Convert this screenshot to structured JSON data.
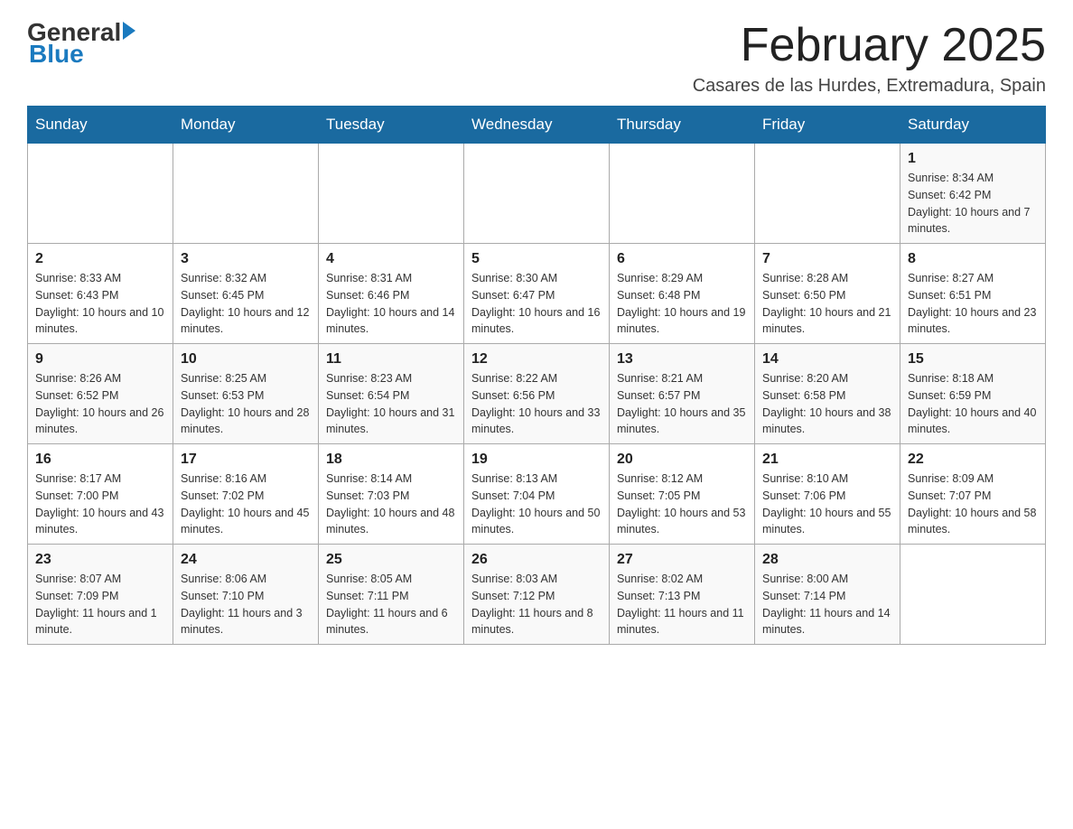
{
  "logo": {
    "general": "General",
    "blue": "Blue"
  },
  "title": "February 2025",
  "location": "Casares de las Hurdes, Extremadura, Spain",
  "days_of_week": [
    "Sunday",
    "Monday",
    "Tuesday",
    "Wednesday",
    "Thursday",
    "Friday",
    "Saturday"
  ],
  "weeks": [
    [
      {
        "day": "",
        "info": ""
      },
      {
        "day": "",
        "info": ""
      },
      {
        "day": "",
        "info": ""
      },
      {
        "day": "",
        "info": ""
      },
      {
        "day": "",
        "info": ""
      },
      {
        "day": "",
        "info": ""
      },
      {
        "day": "1",
        "info": "Sunrise: 8:34 AM\nSunset: 6:42 PM\nDaylight: 10 hours and 7 minutes."
      }
    ],
    [
      {
        "day": "2",
        "info": "Sunrise: 8:33 AM\nSunset: 6:43 PM\nDaylight: 10 hours and 10 minutes."
      },
      {
        "day": "3",
        "info": "Sunrise: 8:32 AM\nSunset: 6:45 PM\nDaylight: 10 hours and 12 minutes."
      },
      {
        "day": "4",
        "info": "Sunrise: 8:31 AM\nSunset: 6:46 PM\nDaylight: 10 hours and 14 minutes."
      },
      {
        "day": "5",
        "info": "Sunrise: 8:30 AM\nSunset: 6:47 PM\nDaylight: 10 hours and 16 minutes."
      },
      {
        "day": "6",
        "info": "Sunrise: 8:29 AM\nSunset: 6:48 PM\nDaylight: 10 hours and 19 minutes."
      },
      {
        "day": "7",
        "info": "Sunrise: 8:28 AM\nSunset: 6:50 PM\nDaylight: 10 hours and 21 minutes."
      },
      {
        "day": "8",
        "info": "Sunrise: 8:27 AM\nSunset: 6:51 PM\nDaylight: 10 hours and 23 minutes."
      }
    ],
    [
      {
        "day": "9",
        "info": "Sunrise: 8:26 AM\nSunset: 6:52 PM\nDaylight: 10 hours and 26 minutes."
      },
      {
        "day": "10",
        "info": "Sunrise: 8:25 AM\nSunset: 6:53 PM\nDaylight: 10 hours and 28 minutes."
      },
      {
        "day": "11",
        "info": "Sunrise: 8:23 AM\nSunset: 6:54 PM\nDaylight: 10 hours and 31 minutes."
      },
      {
        "day": "12",
        "info": "Sunrise: 8:22 AM\nSunset: 6:56 PM\nDaylight: 10 hours and 33 minutes."
      },
      {
        "day": "13",
        "info": "Sunrise: 8:21 AM\nSunset: 6:57 PM\nDaylight: 10 hours and 35 minutes."
      },
      {
        "day": "14",
        "info": "Sunrise: 8:20 AM\nSunset: 6:58 PM\nDaylight: 10 hours and 38 minutes."
      },
      {
        "day": "15",
        "info": "Sunrise: 8:18 AM\nSunset: 6:59 PM\nDaylight: 10 hours and 40 minutes."
      }
    ],
    [
      {
        "day": "16",
        "info": "Sunrise: 8:17 AM\nSunset: 7:00 PM\nDaylight: 10 hours and 43 minutes."
      },
      {
        "day": "17",
        "info": "Sunrise: 8:16 AM\nSunset: 7:02 PM\nDaylight: 10 hours and 45 minutes."
      },
      {
        "day": "18",
        "info": "Sunrise: 8:14 AM\nSunset: 7:03 PM\nDaylight: 10 hours and 48 minutes."
      },
      {
        "day": "19",
        "info": "Sunrise: 8:13 AM\nSunset: 7:04 PM\nDaylight: 10 hours and 50 minutes."
      },
      {
        "day": "20",
        "info": "Sunrise: 8:12 AM\nSunset: 7:05 PM\nDaylight: 10 hours and 53 minutes."
      },
      {
        "day": "21",
        "info": "Sunrise: 8:10 AM\nSunset: 7:06 PM\nDaylight: 10 hours and 55 minutes."
      },
      {
        "day": "22",
        "info": "Sunrise: 8:09 AM\nSunset: 7:07 PM\nDaylight: 10 hours and 58 minutes."
      }
    ],
    [
      {
        "day": "23",
        "info": "Sunrise: 8:07 AM\nSunset: 7:09 PM\nDaylight: 11 hours and 1 minute."
      },
      {
        "day": "24",
        "info": "Sunrise: 8:06 AM\nSunset: 7:10 PM\nDaylight: 11 hours and 3 minutes."
      },
      {
        "day": "25",
        "info": "Sunrise: 8:05 AM\nSunset: 7:11 PM\nDaylight: 11 hours and 6 minutes."
      },
      {
        "day": "26",
        "info": "Sunrise: 8:03 AM\nSunset: 7:12 PM\nDaylight: 11 hours and 8 minutes."
      },
      {
        "day": "27",
        "info": "Sunrise: 8:02 AM\nSunset: 7:13 PM\nDaylight: 11 hours and 11 minutes."
      },
      {
        "day": "28",
        "info": "Sunrise: 8:00 AM\nSunset: 7:14 PM\nDaylight: 11 hours and 14 minutes."
      },
      {
        "day": "",
        "info": ""
      }
    ]
  ]
}
